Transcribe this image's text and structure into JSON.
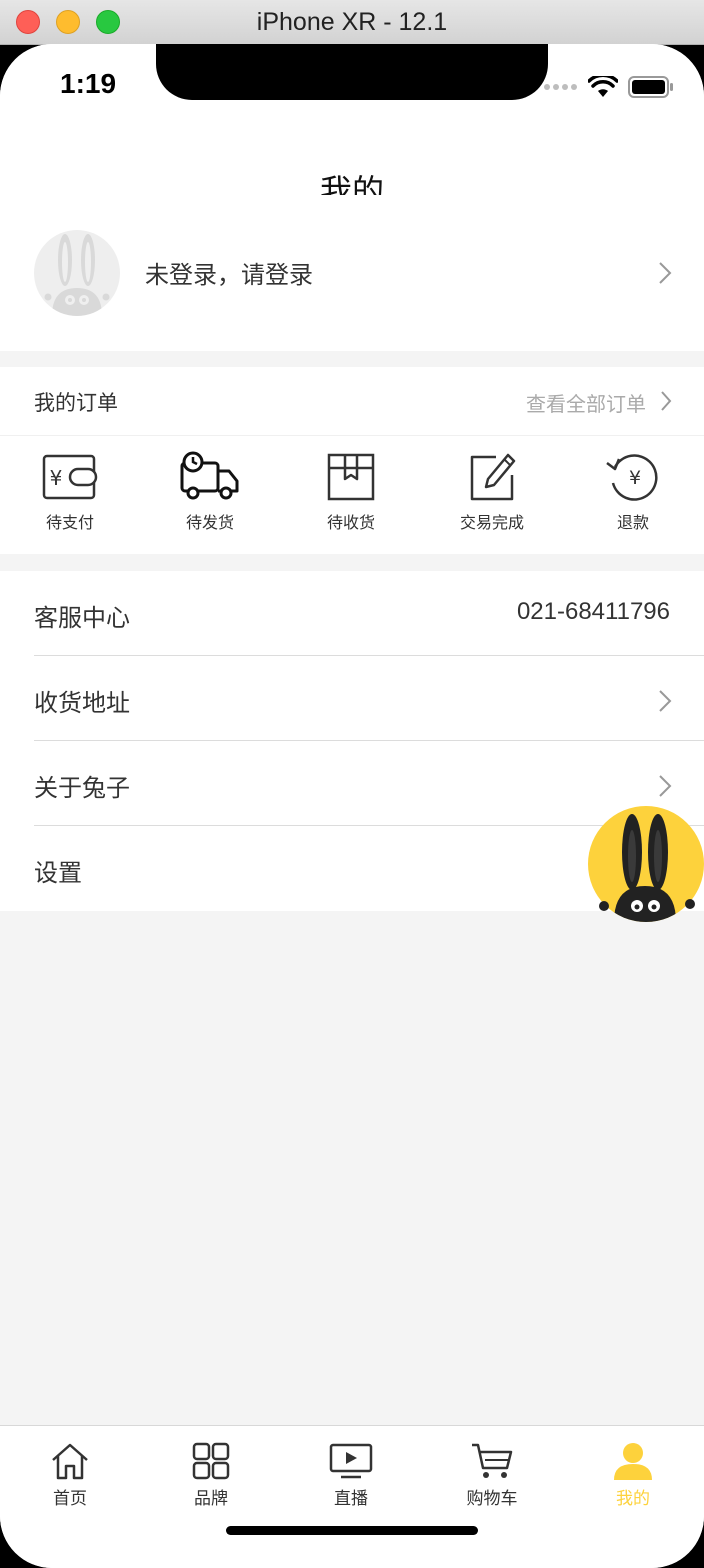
{
  "window": {
    "title": "iPhone XR - 12.1"
  },
  "status_bar": {
    "time": "1:19",
    "icons": [
      "signal-dots-icon",
      "wifi-icon",
      "battery-icon"
    ]
  },
  "nav": {
    "title": "我的"
  },
  "profile": {
    "login_text": "未登录，请登录",
    "avatar_icon": "bunny-avatar-icon"
  },
  "orders": {
    "title": "我的订单",
    "view_all": "查看全部订单",
    "items": [
      {
        "label": "待支付",
        "icon": "wallet-icon"
      },
      {
        "label": "待发货",
        "icon": "truck-icon"
      },
      {
        "label": "待收货",
        "icon": "box-icon"
      },
      {
        "label": "交易完成",
        "icon": "edit-icon"
      },
      {
        "label": "退款",
        "icon": "refund-icon"
      }
    ]
  },
  "menu": {
    "items": [
      {
        "label": "客服中心",
        "value": "021-68411796"
      },
      {
        "label": "收货地址"
      },
      {
        "label": "关于兔子"
      },
      {
        "label": "设置"
      }
    ]
  },
  "tabbar": {
    "items": [
      {
        "label": "首页",
        "icon": "home-icon"
      },
      {
        "label": "品牌",
        "icon": "grid-icon"
      },
      {
        "label": "直播",
        "icon": "live-icon"
      },
      {
        "label": "购物车",
        "icon": "cart-icon"
      },
      {
        "label": "我的",
        "icon": "user-icon",
        "active": true
      }
    ]
  },
  "colors": {
    "accent": "#fdd23c",
    "background": "#f4f4f4",
    "text": "#333333",
    "muted": "#aaaaaa"
  }
}
